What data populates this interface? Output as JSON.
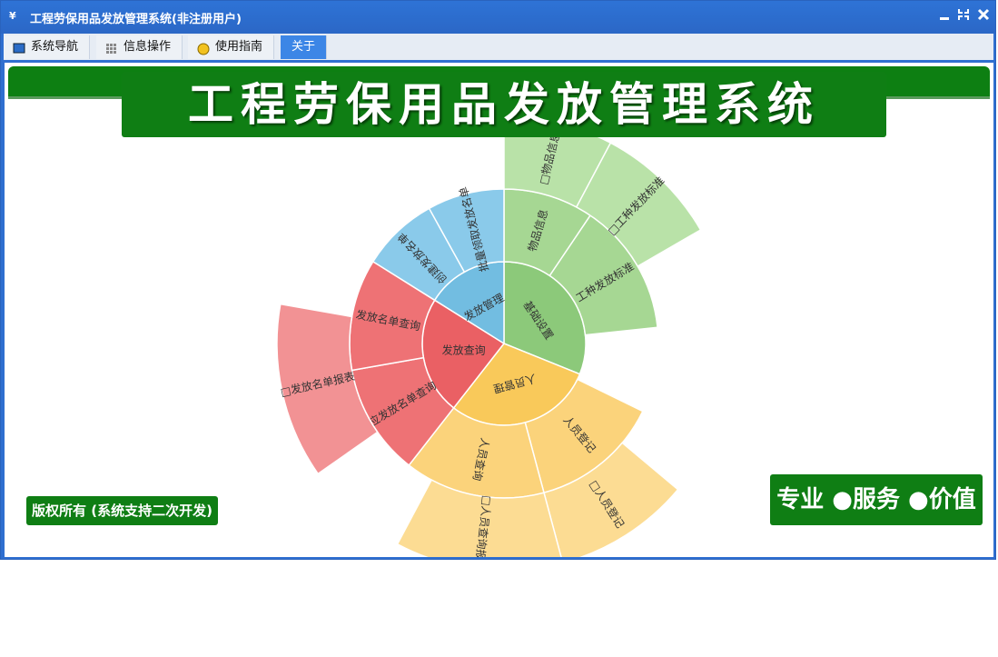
{
  "window": {
    "title": "工程劳保用品发放管理系统(非注册用户)",
    "controls": [
      "minimize-icon",
      "restore-icon",
      "close-icon"
    ]
  },
  "menu": {
    "items": [
      {
        "label": "系统导航",
        "icon": "monitor-icon"
      },
      {
        "label": "信息操作",
        "icon": "grid-icon"
      },
      {
        "label": "使用指南",
        "icon": "bulb-icon"
      },
      {
        "label": "关于",
        "icon": ""
      }
    ]
  },
  "banner": {
    "title": "工程劳保用品发放管理系统"
  },
  "footer": {
    "copyright": "版权所有 (系统支持二次开发)",
    "slogan": "专业 ●服务 ●价值"
  },
  "colors": {
    "green": "#8cc97a",
    "blue": "#72bde1",
    "red": "#ea6064",
    "yellow": "#f9c95a",
    "brand_green": "#0f7e14",
    "title_blue": "#2e73d6"
  },
  "sunburst": {
    "inner": [
      {
        "label": "基础设置",
        "color": "green"
      },
      {
        "label": "人员管理",
        "color": "yellow"
      },
      {
        "label": "发放查询",
        "color": "red"
      },
      {
        "label": "发放管理",
        "color": "blue"
      }
    ],
    "middle": [
      {
        "label": "物品信息",
        "parent": "基础设置"
      },
      {
        "label": "工种发放标准",
        "parent": "基础设置"
      },
      {
        "label": "人员登记",
        "parent": "人员管理"
      },
      {
        "label": "人员查询",
        "parent": "人员管理"
      },
      {
        "label": "应发放名单查询",
        "parent": "发放查询"
      },
      {
        "label": "发放名单查询",
        "parent": "发放查询"
      },
      {
        "label": "创建发放名单",
        "parent": "发放管理"
      },
      {
        "label": "批量领取发放名单",
        "parent": "发放管理"
      }
    ],
    "outer": [
      {
        "label": "□物品信息",
        "parent": "物品信息"
      },
      {
        "label": "□工种发放标准",
        "parent": "工种发放标准"
      },
      {
        "label": "□人员登记",
        "parent": "人员登记"
      },
      {
        "label": "□人员查询报表",
        "parent": "人员查询"
      },
      {
        "label": "□发放名单报表",
        "parent": "发放名单查询"
      }
    ]
  }
}
